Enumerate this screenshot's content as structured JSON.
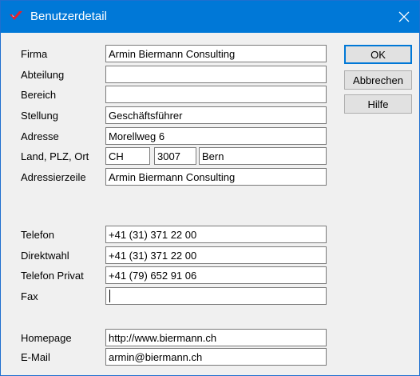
{
  "window": {
    "title": "Benutzerdetail",
    "accent_color": "#0078d7",
    "app_icon": "red-check-icon",
    "close_icon": "close-icon"
  },
  "fields": {
    "firma": {
      "label": "Firma",
      "value": "Armin Biermann Consulting"
    },
    "abteilung": {
      "label": "Abteilung",
      "value": ""
    },
    "bereich": {
      "label": "Bereich",
      "value": ""
    },
    "stellung": {
      "label": "Stellung",
      "value": "Geschäftsführer"
    },
    "adresse": {
      "label": "Adresse",
      "value": "Morellweg 6"
    },
    "land_plz_ort": {
      "label": "Land, PLZ, Ort",
      "land": "CH",
      "plz": "3007",
      "ort": "Bern"
    },
    "adresszeile": {
      "label": "Adressierzeile",
      "value": "Armin Biermann Consulting"
    },
    "telefon": {
      "label": "Telefon",
      "value": "+41 (31) 371 22 00"
    },
    "direktwahl": {
      "label": "Direktwahl",
      "value": "+41 (31) 371 22 00"
    },
    "telefon_privat": {
      "label": "Telefon Privat",
      "value": "+41 (79) 652 91 06"
    },
    "fax": {
      "label": "Fax",
      "value": ""
    },
    "homepage": {
      "label": "Homepage",
      "value": "http://www.biermann.ch"
    },
    "email": {
      "label": "E-Mail",
      "value": "armin@biermann.ch"
    }
  },
  "buttons": {
    "ok": "OK",
    "cancel": "Abbrechen",
    "help": "Hilfe"
  }
}
